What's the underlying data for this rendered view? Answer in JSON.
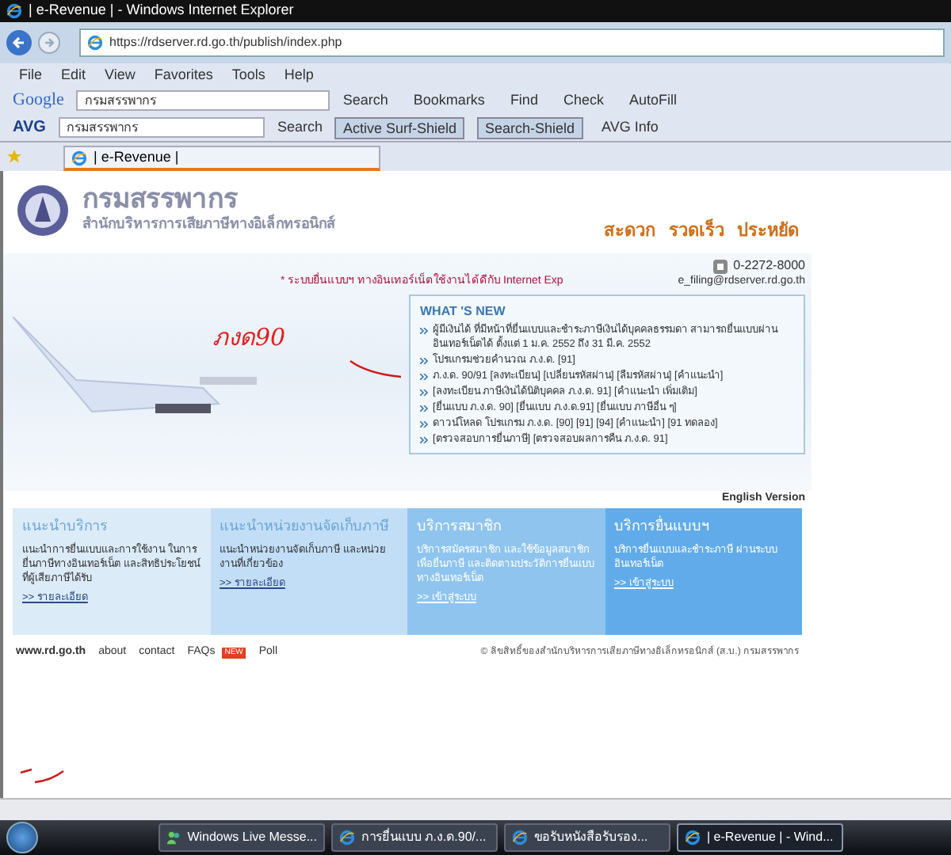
{
  "window": {
    "title": "| e-Revenue | - Windows Internet Explorer"
  },
  "address_bar": {
    "url": "https://rdserver.rd.go.th/publish/index.php"
  },
  "menu": [
    "File",
    "Edit",
    "View",
    "Favorites",
    "Tools",
    "Help"
  ],
  "google_toolbar": {
    "brand": "Google",
    "query": "กรมสรรพากร",
    "search": "Search",
    "buttons": [
      "Bookmarks",
      "Find",
      "Check",
      "AutoFill"
    ]
  },
  "avg_toolbar": {
    "brand": "AVG",
    "query": "กรมสรรพากร",
    "search": "Search",
    "buttons": [
      {
        "label": "Active Surf-Shield",
        "selected": true
      },
      {
        "label": "Search-Shield",
        "selected": true
      },
      {
        "label": "AVG Info",
        "selected": false
      }
    ]
  },
  "tabs": [
    {
      "label": "| e-Revenue |",
      "selected": true
    }
  ],
  "page": {
    "org_name": "กรมสรรพากร",
    "org_unit": "สำนักบริหารการเสียภาษีทางอิเล็กทรอนิกส์",
    "slogans": [
      "สะดวก",
      "รวดเร็ว",
      "ประหยัด"
    ],
    "phone": "0-2272-8000",
    "email": "e_filing@rdserver.rd.go.th",
    "notice": "* ระบบยื่นแบบฯ ทางอินเทอร์เน็ตใช้งานได้ดีกับ Internet Exp",
    "handwritten_note": "ภงด90",
    "whats_new": {
      "title": "WHAT 'S NEW",
      "items": [
        {
          "text": "ผู้มีเงินได้ ที่มีหน้าที่ยื่นแบบและชำระภาษีเงินได้บุคคลธรรมดา สามารถยื่นแบบผ่านอินเทอร์เน็ตได้ ตั้งแต่ 1 ม.ค. 2552 ถึง 31 มี.ค. 2552"
        },
        {
          "text": "โปรแกรมช่วยคำนวณ ภ.ง.ด. [91]"
        },
        {
          "text": "ภ.ง.ด. 90/91 [ลงทะเบียน] [เปลี่ยนรหัสผ่าน] [ลืมรหัสผ่าน] [คำแนะนำ]"
        },
        {
          "text": "[ลงทะเบียน ภาษีเงินได้นิติบุคคล ภ.ง.ด. 91] [คำแนะนำ เพิ่มเติม]"
        },
        {
          "text": "[ยื่นแบบ ภ.ง.ด. 90] [ยื่นแบบ ภ.ง.ด.91] [ยื่นแบบ ภาษีอื่น ๆ]"
        },
        {
          "text": "ดาวน์โหลด โปรแกรม ภ.ง.ด. [90] [91] [94] [คำแนะนำ] [91 ทดลอง]"
        },
        {
          "text": "[ตรวจสอบการยื่นภาษี] [ตรวจสอบผลการคืน ภ.ง.ด. 91]"
        }
      ]
    },
    "english_link": "English Version",
    "cards": [
      {
        "title": "แนะนำบริการ",
        "body": "แนะนำการยื่นแบบและการใช้งาน ในการยื่นภาษีทางอินเทอร์เน็ต และสิทธิประโยชน์ที่ผู้เสียภาษีได้รับ",
        "link": ">> รายละเอียด",
        "color": "#dcebf8"
      },
      {
        "title": "แนะนำหน่วยงานจัดเก็บภาษี",
        "body": "แนะนำหน่วยงานจัดเก็บภาษี และหน่วยงานที่เกี่ยวข้อง",
        "link": ">> รายละเอียด",
        "color": "#c2def6"
      },
      {
        "title": "บริการสมาชิก",
        "body": "บริการสมัครสมาชิก และใช้ข้อมูลสมาชิก เพื่อยื่นภาษี และติดตามประวัติการยื่นแบบทางอินเทอร์เน็ต",
        "link": ">> เข้าสู่ระบบ",
        "color": "#8fc4ef"
      },
      {
        "title": "บริการยื่นแบบฯ",
        "body": "บริการยื่นแบบและชำระภาษี ผ่านระบบอินเทอร์เน็ต",
        "link": ">> เข้าสู่ระบบ",
        "color": "#62abea"
      }
    ],
    "footer": {
      "site": "www.rd.go.th",
      "links": [
        "about",
        "contact",
        "FAQs",
        "Poll"
      ],
      "badge": "NEW",
      "copyright": "© ลิขสิทธิ์ของสำนักบริหารการเสียภาษีทางอิเล็กทรอนิกส์ (ส.บ.) กรมสรรพากร"
    }
  },
  "taskbar": {
    "items": [
      {
        "label": "Windows Live Messe...",
        "kind": "messenger",
        "selected": false
      },
      {
        "label": "การยื่นแบบ ภ.ง.ด.90/...",
        "kind": "browser",
        "selected": false
      },
      {
        "label": "ขอรับหนังสือรับรอง...",
        "kind": "browser",
        "selected": false
      },
      {
        "label": "| e-Revenue | - Wind...",
        "kind": "browser",
        "selected": true
      }
    ]
  }
}
